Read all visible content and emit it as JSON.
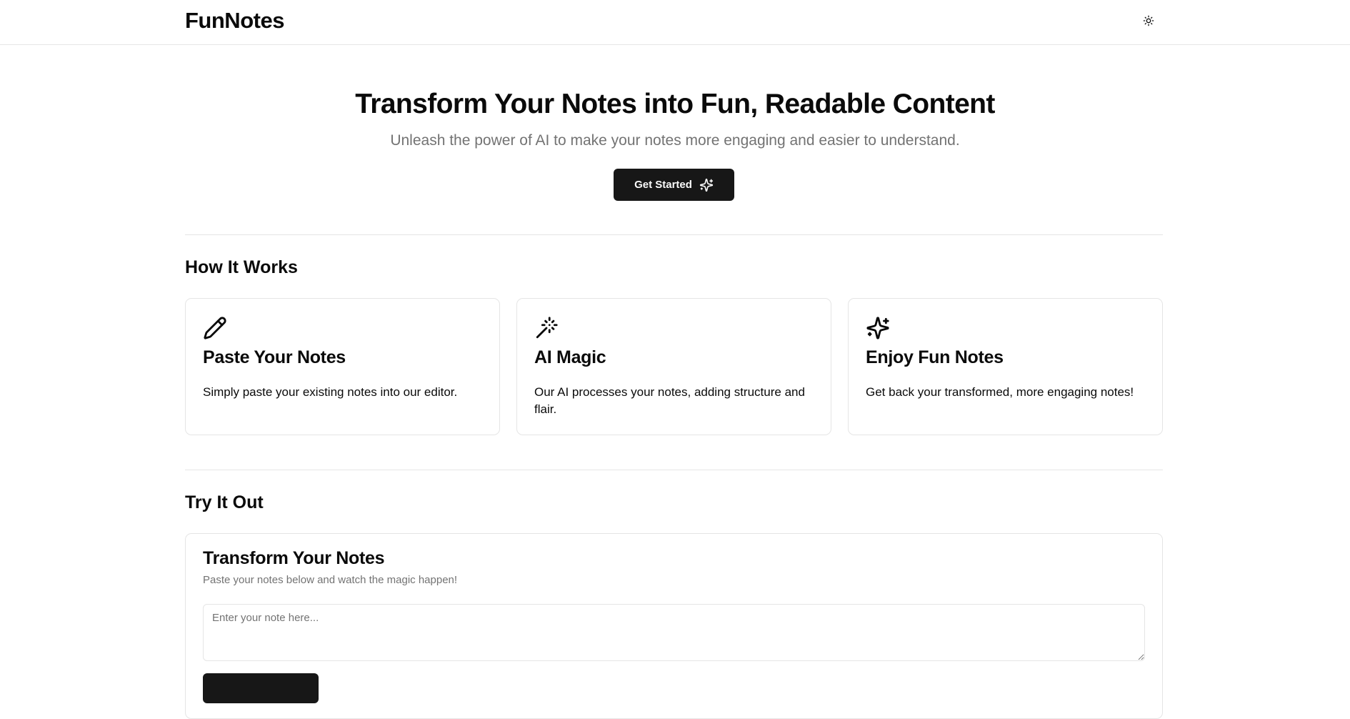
{
  "header": {
    "brand": "FunNotes",
    "theme_toggle_icon": "sun-icon"
  },
  "hero": {
    "title": "Transform Your Notes into Fun, Readable Content",
    "subtitle": "Unleash the power of AI to make your notes more engaging and easier to understand.",
    "cta_label": "Get Started",
    "cta_icon": "sparkles-icon"
  },
  "how_it_works": {
    "title": "How It Works",
    "steps": [
      {
        "icon": "pencil-icon",
        "title": "Paste Your Notes",
        "text": "Simply paste your existing notes into our editor."
      },
      {
        "icon": "magic-wand-icon",
        "title": "AI Magic",
        "text": "Our AI processes your notes, adding structure and flair."
      },
      {
        "icon": "sparkles-icon",
        "title": "Enjoy Fun Notes",
        "text": "Get back your transformed, more engaging notes!"
      }
    ]
  },
  "try_it_out": {
    "title": "Try It Out",
    "card_title": "Transform Your Notes",
    "card_description": "Paste your notes below and watch the magic happen!",
    "input_placeholder": "Enter your note here...",
    "input_value": ""
  },
  "colors": {
    "primary": "#171717",
    "muted_text": "#737373",
    "border": "#e5e5e5",
    "background": "#ffffff"
  }
}
